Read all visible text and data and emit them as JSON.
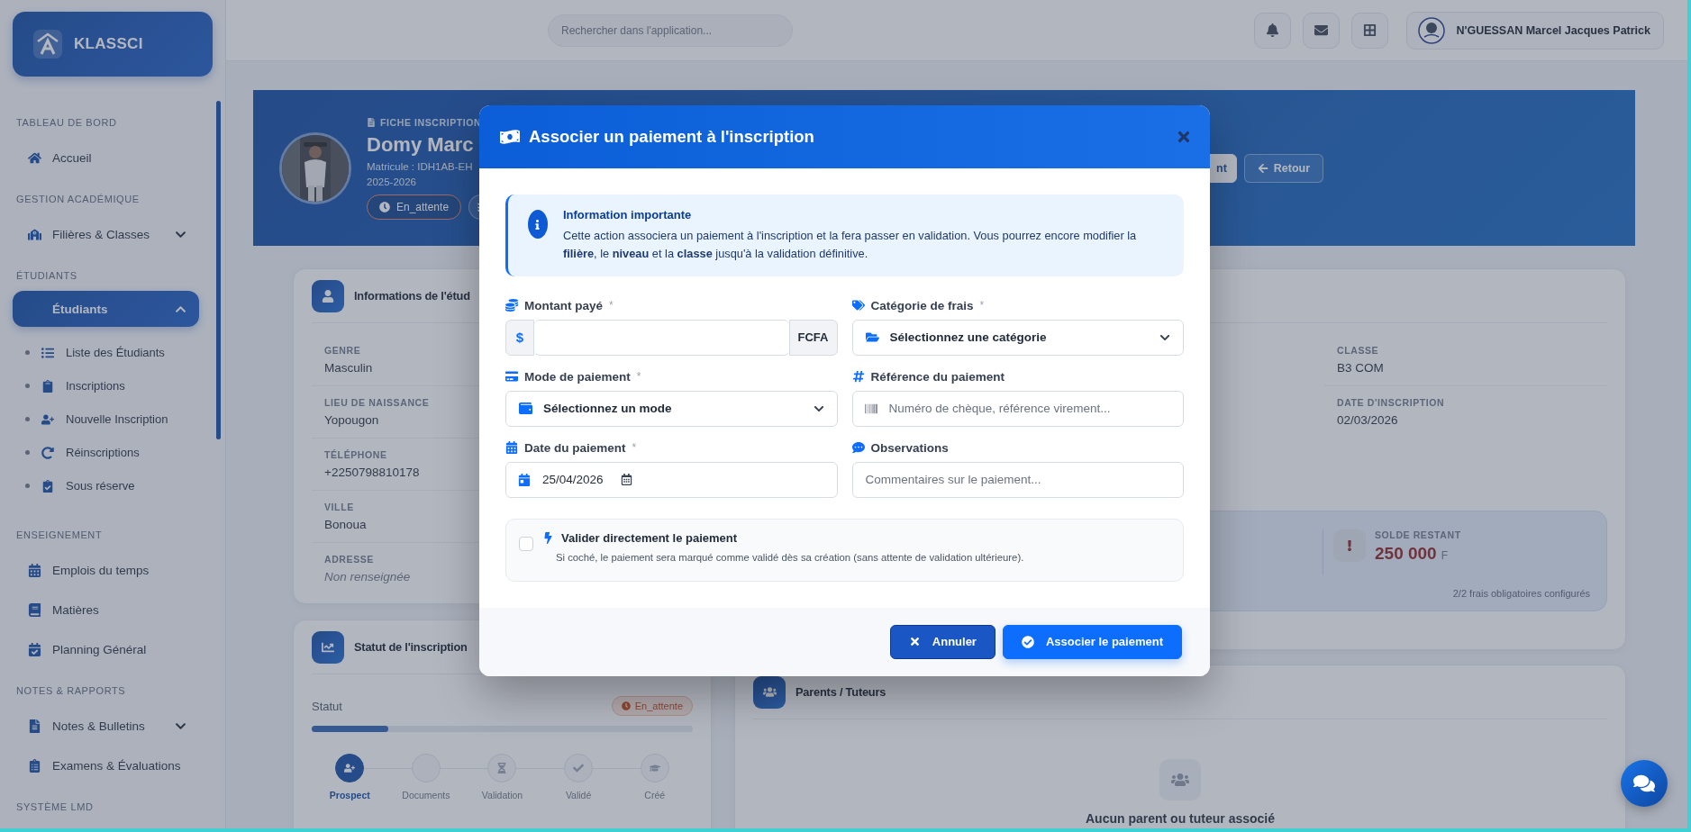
{
  "sidebar": {
    "brand": "KLASSCI",
    "sections": [
      {
        "title": "TABLEAU DE BORD",
        "items": [
          {
            "label": "Accueil",
            "selected": false
          }
        ]
      },
      {
        "title": "GESTION ACADÉMIQUE",
        "items": [
          {
            "label": "Filières & Classes",
            "selected": false,
            "expanded": false
          }
        ]
      },
      {
        "title": "ÉTUDIANTS",
        "items": [
          {
            "label": "Étudiants",
            "selected": true,
            "expanded": true,
            "children": [
              {
                "label": "Liste des Étudiants",
                "selected": false
              },
              {
                "label": "Inscriptions",
                "selected": false
              },
              {
                "label": "Nouvelle Inscription",
                "selected": false
              },
              {
                "label": "Réinscriptions",
                "selected": false
              },
              {
                "label": "Sous réserve",
                "selected": false
              }
            ]
          }
        ]
      },
      {
        "title": "ENSEIGNEMENT",
        "items": [
          {
            "label": "Emplois du temps",
            "selected": false
          },
          {
            "label": "Matières",
            "selected": false
          },
          {
            "label": "Planning Général",
            "selected": false
          }
        ]
      },
      {
        "title": "NOTES & RAPPORTS",
        "items": [
          {
            "label": "Notes & Bulletins",
            "selected": false,
            "expanded": false
          },
          {
            "label": "Examens & Évaluations",
            "selected": false
          }
        ]
      },
      {
        "title": "SYSTÈME LMD"
      }
    ]
  },
  "topbar": {
    "search": {
      "placeholder": "Rechercher dans l'application..."
    },
    "user": {
      "name": "N'GUESSAN Marcel Jacques Patrick"
    }
  },
  "hero": {
    "eyebrow": "FICHE INSCRIPTION",
    "name": "Domy Marc",
    "matricule": "Matricule : IDH1AB-EH",
    "year": "2025-2026",
    "status_badge": "En_attente",
    "actions": [
      {
        "label": "nt",
        "kind": "light"
      },
      {
        "label": "Retour",
        "kind": "outline"
      }
    ]
  },
  "student_info": {
    "title": "Informations de l'étud",
    "fields": [
      {
        "label": "GENRE",
        "value": "Masculin",
        "missing": false
      },
      {
        "label": "LIEU DE NAISSANCE",
        "value": "Yopougon",
        "missing": false
      },
      {
        "label": "TÉLÉPHONE",
        "value": "+2250798810178",
        "missing": false
      },
      {
        "label": "VILLE",
        "value": "Bonoua",
        "missing": false
      },
      {
        "label": "ADRESSE",
        "value": "Non renseignée",
        "missing": true
      }
    ]
  },
  "enrollment": {
    "fields": [
      {
        "label": "CLASSE",
        "value": "B3 COM"
      },
      {
        "label": "DATE D'INSCRIPTION",
        "value": "02/03/2026"
      }
    ],
    "balance": {
      "label": "SOLDE RESTANT",
      "amount": "250 000",
      "unit": "F",
      "note": "2/2 frais obligatoires configurés"
    }
  },
  "status_card": {
    "title": "Statut de l'inscription",
    "label": "Statut",
    "badge": "En_attente",
    "level": 0.2,
    "steps": [
      {
        "label": "Prospect",
        "active": true
      },
      {
        "label": "Documents",
        "active": false
      },
      {
        "label": "Validation",
        "active": false
      },
      {
        "label": "Validé",
        "active": false
      },
      {
        "label": "Créé",
        "active": false
      }
    ]
  },
  "parents_card": {
    "title": "Parents / Tuteurs",
    "empty_text": "Aucun parent ou tuteur associé"
  },
  "modal": {
    "title": "Associer un paiement à l'inscription",
    "info": {
      "title": "Information importante",
      "text": "Cette action associera un paiement à l'inscription et la fera passer en validation. Vous pourrez encore modifier la **filière**, le **niveau** et la **classe** jusqu'à la validation définitive."
    },
    "fields": [
      {
        "kind": "amount",
        "label": "Montant payé",
        "required_mark": "*",
        "prefix": "$",
        "suffix": "FCFA"
      },
      {
        "kind": "select",
        "label": "Catégorie de frais",
        "required_mark": "*",
        "value": "Sélectionnez une catégorie"
      },
      {
        "kind": "select",
        "label": "Mode de paiement",
        "required_mark": "*",
        "value": "Sélectionnez un mode"
      },
      {
        "kind": "text",
        "label": "Référence du paiement",
        "placeholder": "Numéro de chèque, référence virement..."
      },
      {
        "kind": "date",
        "label": "Date du paiement",
        "required_mark": "*",
        "value": "25/04/2026"
      },
      {
        "kind": "text",
        "label": "Observations",
        "placeholder": "Commentaires sur le paiement..."
      }
    ],
    "option": {
      "label": "Valider directement le paiement",
      "hint": "Si coché, le paiement sera marqué comme validé dès sa création (sans attente de validation ultérieure).",
      "checked": false
    },
    "buttons": [
      {
        "label": "Annuler",
        "kind": "secondary"
      },
      {
        "label": "Associer le paiement",
        "kind": "primary"
      }
    ]
  }
}
